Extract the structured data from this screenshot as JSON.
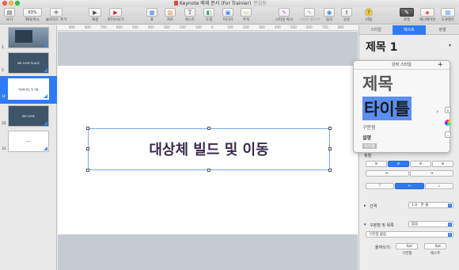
{
  "window": {
    "title": "Keynote 예제 문서 (For Trainier)",
    "edited": "편집됨"
  },
  "toolbar": {
    "view": "보기",
    "zoom_value": "63%",
    "zoom_label": "확대/축소",
    "add_slide": "슬라이드 추가",
    "play": "재생",
    "live": "라이브보기",
    "table": "표",
    "chart": "차트",
    "text": "텍스트",
    "shape": "도형",
    "media": "미디어",
    "comment": "주석",
    "style_copy": "스타일 복사",
    "style_paste": "스타일 붙이기",
    "link": "링크",
    "share": "공유",
    "tips": "비법",
    "format": "포맷",
    "animate": "애니메이션",
    "document": "도큐멘트"
  },
  "navigator": {
    "slides": [
      {
        "num": "1",
        "text": ""
      },
      {
        "num": "5",
        "text": "WE LOVE PLACE"
      },
      {
        "num": "16",
        "text": "대상체 빌드 및 이동"
      },
      {
        "num": "26",
        "text": "WE LOVE"
      },
      {
        "num": "31",
        "text": ""
      }
    ]
  },
  "ruler": [
    "900",
    "800",
    "700",
    "600",
    "500",
    "400",
    "300",
    "200",
    "100",
    "0",
    "100",
    "200",
    "300",
    "400",
    "500",
    "600",
    "700",
    "800",
    "900"
  ],
  "slide": {
    "title": "대상체 빌드 및 이동"
  },
  "inspector": {
    "tabs": [
      "스타일",
      "텍스트",
      "정렬"
    ],
    "active_tab": "텍스트",
    "style_name": "제목 1",
    "spacing_label": "간격",
    "spacing_value": "1.0 - 한 줄",
    "bullets_label": "구분점 및 목록",
    "bullets_value": "없음",
    "bullets_select": "구분점 없음",
    "indent_label": "들여쓰기:",
    "indent_bullet_value": "0pt",
    "indent_text_value": "0pt",
    "indent_bullet_caption": "구분점",
    "indent_text_caption": "텍스트",
    "align_label": "정렬"
  },
  "popover": {
    "header": "단락 스타일",
    "add": "+",
    "items": [
      "제목",
      "타이틀",
      "구분점",
      "설명",
      "레이블"
    ],
    "selected": "타이틀"
  },
  "colors": {
    "accent": "#2f7bf6",
    "slide_title": "#3a2a4c",
    "thumb_dark": "#3e5468"
  }
}
